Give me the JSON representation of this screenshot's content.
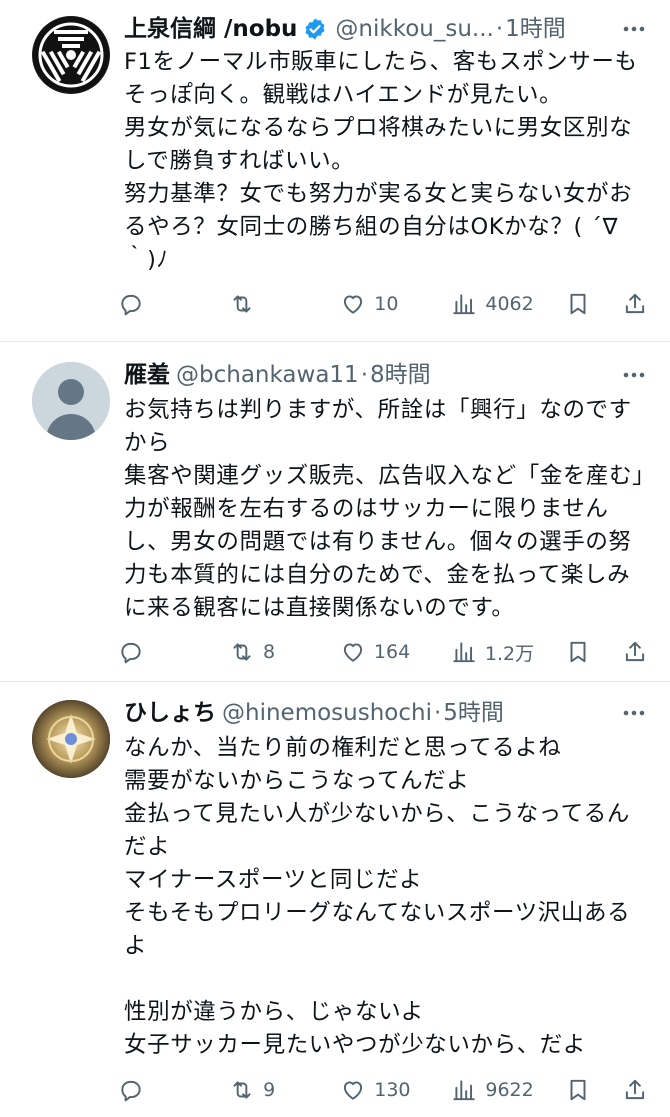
{
  "colors": {
    "text": "#0f1419",
    "secondary": "#536471",
    "verified": "#1d9bf0",
    "divider": "#e6e8eb"
  },
  "posts": [
    {
      "display_name": "上泉信綱 /nobu",
      "verified": true,
      "handle": "@nikkou_su...",
      "time": "1時間",
      "avatar_icon": "emblem-logo",
      "text": "F1をノーマル市販車にしたら、客もスポンサーもそっぽ向く。観戦はハイエンドが見たい。\n男女が気になるならプロ将棋みたいに男女区別なしで勝負すればいい。\n努力基準？女でも努力が実る女と実らない女がおるやろ？女同士の勝ち組の自分はOKかな？( ´∇｀)ﾉ",
      "actions": {
        "reply": "",
        "retweet": "",
        "like": "10",
        "views": "4062"
      }
    },
    {
      "display_name": "雁羞",
      "verified": false,
      "handle": "@bchankawa11",
      "time": "8時間",
      "avatar_icon": "default-avatar",
      "text": "お気持ちは判りますが、所詮は「興行」なのですから\n集客や関連グッズ販売、広告収入など「金を産む」力が報酬を左右するのはサッカーに限りませんし、男女の問題では有りません。個々の選手の努力も本質的には自分のためで、金を払って楽しみに来る観客には直接関係ないのです。",
      "actions": {
        "reply": "",
        "retweet": "8",
        "like": "164",
        "views": "1.2万"
      }
    },
    {
      "display_name": "ひしょち",
      "verified": false,
      "handle": "@hinemosushochi",
      "time": "5時間",
      "avatar_icon": "gold-emblem-avatar",
      "text": "なんか、当たり前の権利だと思ってるよね\n需要がないからこうなってんだよ\n金払って見たい人が少ないから、こうなってるんだよ\nマイナースポーツと同じだよ\nそもそもプロリーグなんてないスポーツ沢山あるよ\n\n性別が違うから、じゃないよ\n女子サッカー見たいやつが少ないから、だよ",
      "actions": {
        "reply": "",
        "retweet": "9",
        "like": "130",
        "views": "9622"
      }
    }
  ]
}
